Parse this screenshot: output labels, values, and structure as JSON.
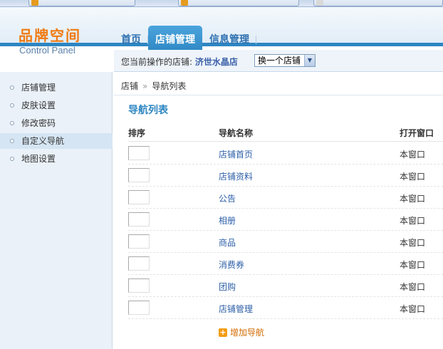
{
  "header": {
    "logo_title": "品牌空间",
    "logo_subtitle": "Control Panel",
    "nav": [
      {
        "label": "首页"
      },
      {
        "label": "店铺管理"
      },
      {
        "label": "信息管理"
      }
    ]
  },
  "shopbar": {
    "label": "您当前操作的店铺:",
    "shop_name": "济世水晶店",
    "select_value": "换一个店铺"
  },
  "sidebar": {
    "items": [
      {
        "label": "店铺管理"
      },
      {
        "label": "皮肤设置"
      },
      {
        "label": "修改密码"
      },
      {
        "label": "自定义导航"
      },
      {
        "label": "地图设置"
      }
    ]
  },
  "main": {
    "breadcrumb": [
      "店铺",
      "导航列表"
    ],
    "breadcrumb_sep": "»",
    "section_title": "导航列表",
    "columns": {
      "sort": "排序",
      "name": "导航名称",
      "open": "打开窗口"
    },
    "rows": [
      {
        "name": "店铺首页",
        "open": "本窗口"
      },
      {
        "name": "店铺资料",
        "open": "本窗口"
      },
      {
        "name": "公告",
        "open": "本窗口"
      },
      {
        "name": "相册",
        "open": "本窗口"
      },
      {
        "name": "商品",
        "open": "本窗口"
      },
      {
        "name": "消费券",
        "open": "本窗口"
      },
      {
        "name": "团购",
        "open": "本窗口"
      },
      {
        "name": "店铺管理",
        "open": "本窗口"
      }
    ],
    "add_label": "增加导航"
  },
  "colors": {
    "accent": "#2d86c2",
    "logo": "#ef7a11",
    "link": "#2d5fa8",
    "add": "#d36a00"
  }
}
